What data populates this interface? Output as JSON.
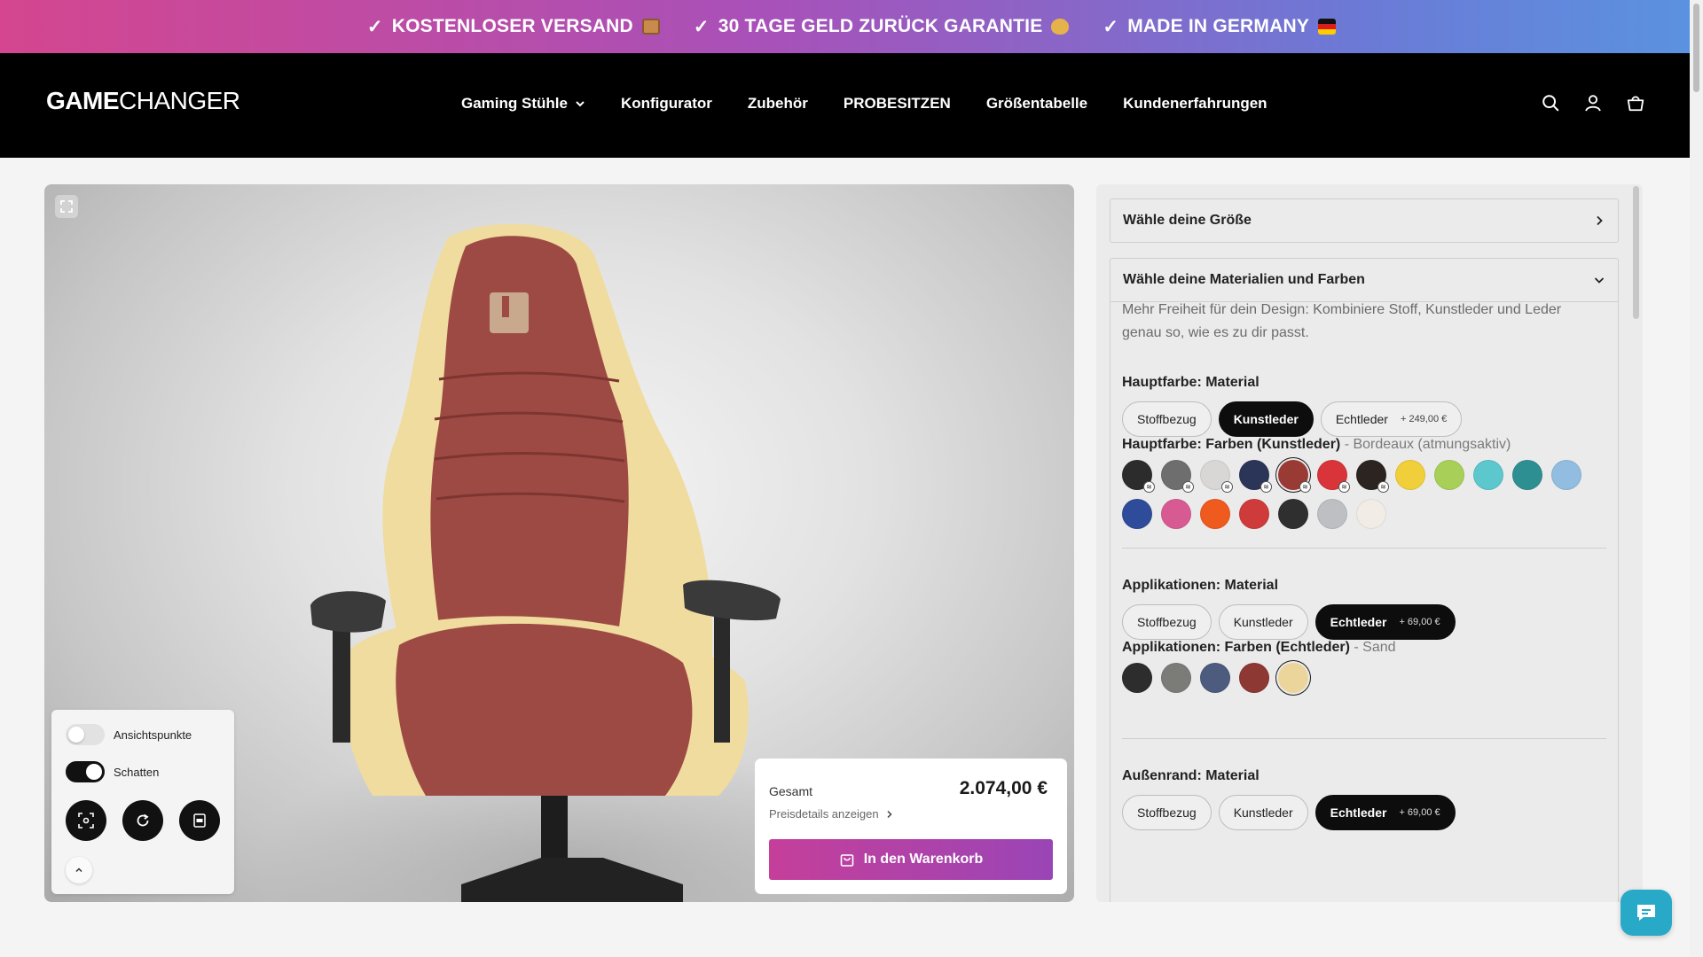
{
  "announcement": {
    "items": [
      {
        "check": "✓",
        "text": "KOSTENLOSER VERSAND",
        "emoji": "package-emoji"
      },
      {
        "check": "✓",
        "text": "30 TAGE GELD ZURÜCK GARANTIE",
        "emoji": "money-bag-emoji"
      },
      {
        "check": "✓",
        "text": "MADE IN GERMANY",
        "emoji": "german-flag-emoji"
      }
    ]
  },
  "header": {
    "logo_bold": "GAME",
    "logo_regular": "CHANGER",
    "nav": [
      {
        "label": "Gaming Stühle",
        "has_dropdown": true
      },
      {
        "label": "Konfigurator"
      },
      {
        "label": "Zubehör"
      },
      {
        "label": "PROBESITZEN"
      },
      {
        "label": "Größentabelle"
      },
      {
        "label": "Kundenerfahrungen"
      }
    ],
    "icons": [
      "search-icon",
      "account-icon",
      "cart-icon"
    ]
  },
  "viewer": {
    "toggles": [
      {
        "label": "Ansichtspunkte",
        "on": false
      },
      {
        "label": "Schatten",
        "on": true
      }
    ],
    "buttons": [
      "focus-icon",
      "reset-view-icon",
      "pdf-icon"
    ],
    "chair_colors": {
      "main": "#9e4a44",
      "accent": "#f0dc9f",
      "armrest": "#3a3a3a"
    }
  },
  "price": {
    "label": "Gesamt",
    "value": "2.074,00 €",
    "details_link": "Preisdetails anzeigen",
    "cart_button": "In den Warenkorb"
  },
  "config": {
    "size_accordion": "Wähle deine Größe",
    "materials_accordion": "Wähle deine Materialien und Farben",
    "intro": "Mehr Freiheit für dein Design: Kombiniere Stoff, Kunstleder und Leder genau so, wie es zu dir passt.",
    "main_material": {
      "title": "Hauptfarbe: Material",
      "options": [
        {
          "label": "Stoffbezug",
          "surcharge": "",
          "active": false
        },
        {
          "label": "Kunstleder",
          "surcharge": "",
          "active": true
        },
        {
          "label": "Echtleder",
          "surcharge": "+ 249,00 €",
          "active": false
        }
      ]
    },
    "main_colors": {
      "title": "Hauptfarbe: Farben (Kunstleder)",
      "selected_name": "- Bordeaux (atmungsaktiv)",
      "swatches": [
        {
          "color": "#2c2c2c",
          "breathable": true,
          "selected": false
        },
        {
          "color": "#6e6e6e",
          "breathable": true,
          "selected": false
        },
        {
          "color": "#d9d6d6",
          "breathable": true,
          "selected": false
        },
        {
          "color": "#2b3558",
          "breathable": true,
          "selected": false
        },
        {
          "color": "#9a3a34",
          "breathable": true,
          "selected": true
        },
        {
          "color": "#d8343a",
          "breathable": true,
          "selected": false
        },
        {
          "color": "#2b2420",
          "breathable": true,
          "selected": false
        },
        {
          "color": "#f0cf3a",
          "breathable": false,
          "selected": false
        },
        {
          "color": "#a8cf57",
          "breathable": false,
          "selected": false
        },
        {
          "color": "#5cc7cc",
          "breathable": false,
          "selected": false
        },
        {
          "color": "#2e8f92",
          "breathable": false,
          "selected": false
        },
        {
          "color": "#92bde0",
          "breathable": false,
          "selected": false
        },
        {
          "color": "#2f4c9a",
          "breathable": false,
          "selected": false
        },
        {
          "color": "#d85a92",
          "breathable": false,
          "selected": false
        },
        {
          "color": "#ef5a1f",
          "breathable": false,
          "selected": false
        },
        {
          "color": "#cf3b3b",
          "breathable": false,
          "selected": false
        },
        {
          "color": "#2f2f2f",
          "breathable": false,
          "selected": false
        },
        {
          "color": "#bdbfc2",
          "breathable": false,
          "selected": false
        },
        {
          "color": "#f1ede6",
          "breathable": false,
          "selected": false
        }
      ]
    },
    "app_material": {
      "title": "Applikationen: Material",
      "options": [
        {
          "label": "Stoffbezug",
          "surcharge": "",
          "active": false
        },
        {
          "label": "Kunstleder",
          "surcharge": "",
          "active": false
        },
        {
          "label": "Echtleder",
          "surcharge": "+ 69,00 €",
          "active": true
        }
      ]
    },
    "app_colors": {
      "title": "Applikationen: Farben (Echtleder)",
      "selected_name": "- Sand",
      "swatches": [
        {
          "color": "#2d2d2d",
          "selected": false
        },
        {
          "color": "#7b7b77",
          "selected": false
        },
        {
          "color": "#4c5b7e",
          "selected": false
        },
        {
          "color": "#8d3833",
          "selected": false
        },
        {
          "color": "#ecd59a",
          "selected": true
        }
      ]
    },
    "edge_material": {
      "title": "Außenrand: Material",
      "options": [
        {
          "label": "Stoffbezug",
          "surcharge": "",
          "active": false
        },
        {
          "label": "Kunstleder",
          "surcharge": "",
          "active": false
        },
        {
          "label": "Echtleder",
          "surcharge": "+ 69,00 €",
          "active": true
        }
      ]
    }
  }
}
